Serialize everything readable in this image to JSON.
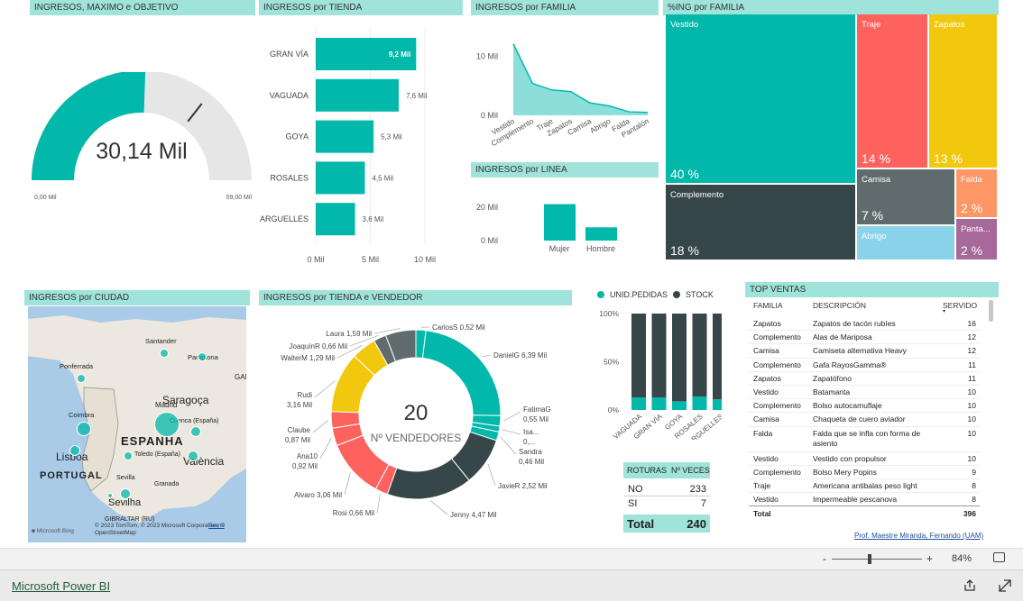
{
  "colors": {
    "teal": "#01b8aa",
    "dark": "#374649",
    "red": "#fd625e",
    "yellow": "#f2c80f",
    "gray": "#5f6b6d",
    "lightblue": "#8ad4eb",
    "orange": "#fe9666",
    "purple": "#a66999",
    "header": "#9fe3da"
  },
  "titles": {
    "gauge": "INGRESOS, MAXIMO e OBJETIVO",
    "tienda": "INGRESOS por TIENDA",
    "familia": "INGRESOS por FAMILIA",
    "treemap": "%ING por FAMILIA",
    "linea": "INGRESOS por LINEA",
    "ciudad": "INGRESOS por CIUDAD",
    "donut": "INGRESOS por TIENDA e VENDEDOR",
    "top": "TOP VENTAS"
  },
  "chart_data": [
    {
      "type": "gauge",
      "value": 30.14,
      "value_label": "30,14 Mil",
      "min_label": "0,00 Mil",
      "max_label": "59,00 Mil",
      "min": 0,
      "max": 59,
      "target": 42
    },
    {
      "type": "bar",
      "orientation": "horizontal",
      "categories": [
        "GRAN VÍA",
        "VAGUADA",
        "GOYA",
        "ROSALES",
        "ARGUELLES"
      ],
      "values": [
        9.2,
        7.6,
        5.3,
        4.5,
        3.6
      ],
      "data_labels": [
        "9,2 Mil",
        "7,6 Mil",
        "5,3 Mil",
        "4,5 Mil",
        "3,6 Mil"
      ],
      "xticks": [
        "0 Mil",
        "5 Mil",
        "10 Mil"
      ],
      "xlim": [
        0,
        10
      ]
    },
    {
      "type": "area",
      "categories": [
        "Vestido",
        "Complemento",
        "Traje",
        "Zapatos",
        "Camisa",
        "Abrigo",
        "Falda",
        "Pantalón"
      ],
      "values": [
        12.1,
        5.4,
        4.3,
        4.0,
        2.1,
        1.6,
        0.6,
        0.5
      ],
      "yticks": [
        "0 Mil",
        "10 Mil"
      ],
      "ylim": [
        0,
        12.5
      ]
    },
    {
      "type": "treemap",
      "items": [
        {
          "label": "Vestido",
          "pct": "40 %",
          "color": "#01b8aa"
        },
        {
          "label": "Complemento",
          "pct": "18 %",
          "color": "#374649"
        },
        {
          "label": "Traje",
          "pct": "14 %",
          "color": "#fd625e"
        },
        {
          "label": "Zapatos",
          "pct": "13 %",
          "color": "#f2c80f"
        },
        {
          "label": "Camisa",
          "pct": "7 %",
          "color": "#5f6b6d"
        },
        {
          "label": "Abrigo",
          "pct": "",
          "color": "#8ad4eb"
        },
        {
          "label": "Falda",
          "pct": "2 %",
          "color": "#fe9666"
        },
        {
          "label": "Panta...",
          "pct": "2 %",
          "color": "#a66999"
        }
      ]
    },
    {
      "type": "bar",
      "categories": [
        "Mujer",
        "Hombre"
      ],
      "values": [
        22,
        8
      ],
      "yticks": [
        "0 Mil",
        "20 Mil"
      ],
      "ylim": [
        0,
        25
      ]
    },
    {
      "type": "donut",
      "center_value": "20",
      "center_label": "Nº VENDEDORES",
      "slices": [
        {
          "label": "CarlosS 0,52 Mil",
          "value": 0.52,
          "color": "#01b8aa"
        },
        {
          "label": "DanielG 6,39 Mil",
          "value": 6.39,
          "color": "#01b8aa"
        },
        {
          "label": "FatimaG 0,55 Mil",
          "value": 0.55,
          "color": "#01b8aa"
        },
        {
          "label": "Isa... 0,...",
          "value": 0.3,
          "color": "#01b8aa"
        },
        {
          "label": "Sandra 0,46 Mil",
          "value": 0.46,
          "color": "#01b8aa"
        },
        {
          "label": "JavieR 2,52 Mil",
          "value": 2.52,
          "color": "#374649"
        },
        {
          "label": "Jenny 4,47 Mil",
          "value": 4.47,
          "color": "#374649"
        },
        {
          "label": "Rosi 0,66 Mil",
          "value": 0.66,
          "color": "#fd625e"
        },
        {
          "label": "Alvaro 3,06 Mil",
          "value": 3.06,
          "color": "#fd625e"
        },
        {
          "label": "Ana10 0,92 Mil",
          "value": 0.92,
          "color": "#fd625e"
        },
        {
          "label": "Claube 0,87 Mil",
          "value": 0.87,
          "color": "#fd625e"
        },
        {
          "label": "Rudi 3,16 Mil",
          "value": 3.16,
          "color": "#f2c80f"
        },
        {
          "label": "WalterM 1,29 Mil",
          "value": 1.29,
          "color": "#f2c80f"
        },
        {
          "label": "JoaquínR 0,66 Mil",
          "value": 0.66,
          "color": "#5f6b6d"
        },
        {
          "label": "Laura 1,59 Mil",
          "value": 1.59,
          "color": "#5f6b6d"
        }
      ]
    },
    {
      "type": "bar",
      "stacked": true,
      "legend": [
        "UNID.PEDIDAS",
        "STOCK"
      ],
      "categories": [
        "VAGUADA",
        "GRAN VÍA",
        "GOYA",
        "ROSALES",
        "ARGUELLES"
      ],
      "series": [
        {
          "name": "UNID.PEDIDAS",
          "values": [
            13,
            13,
            9,
            14,
            11
          ]
        },
        {
          "name": "STOCK",
          "values": [
            87,
            87,
            91,
            86,
            89
          ]
        }
      ],
      "yticks": [
        "0%",
        "50%",
        "100%"
      ],
      "ylim": [
        0,
        100
      ]
    }
  ],
  "map": {
    "cities": [
      "Santander",
      "Pamplona",
      "Ponferrada",
      "Saragoça",
      "Madrid",
      "Cuenca (España)",
      "Coimbra",
      "Lisboa",
      "ESPANHA",
      "Toledo (España)",
      "València",
      "PORTUGAL",
      "Sevilla",
      "Granada",
      "Sevilha",
      "GIBRALTAR (RU)",
      "GAMMA"
    ],
    "attribution": "© 2023 TomTom, © 2023 Microsoft Corporation, © OpenStreetMap",
    "terms": "Terms",
    "brand": "Microsoft Bing"
  },
  "roturas": {
    "headers": [
      "ROTURAS",
      "Nº VECES"
    ],
    "rows": [
      [
        "NO",
        "233"
      ],
      [
        "SI",
        "7"
      ]
    ],
    "total": [
      "Total",
      "240"
    ]
  },
  "top_ventas": {
    "headers": [
      "FAMILIA",
      "DESCRIPCIÓN",
      "SERVIDO"
    ],
    "rows": [
      [
        "Zapatos",
        "Zapatos de tacón rubíes",
        "16"
      ],
      [
        "Complemento",
        "Alas de Mariposa",
        "12"
      ],
      [
        "Camisa",
        "Camiseta alternativa Heavy",
        "12"
      ],
      [
        "Complemento",
        "Gafa RayosGamma®",
        "11"
      ],
      [
        "Zapatos",
        "Zapatófono",
        "11"
      ],
      [
        "Vestido",
        "Batamanta",
        "10"
      ],
      [
        "Complemento",
        "Bolso autocamuflaje",
        "10"
      ],
      [
        "Camisa",
        "Chaqueta de cuero aviador",
        "10"
      ],
      [
        "Falda",
        "Falda que se infla con forma de asiento",
        "10"
      ],
      [
        "Vestido",
        "Vestido con propulsor",
        "10"
      ],
      [
        "Complemento",
        "Bolso Mery Popins",
        "9"
      ],
      [
        "Traje",
        "Americana antibalas peso light",
        "8"
      ],
      [
        "Vestido",
        "Impermeable pescanova",
        "8"
      ]
    ],
    "total": [
      "Total",
      "",
      "396"
    ]
  },
  "credit": "Prof. Maestre Miranda, Fernando (UAM)",
  "footer": {
    "zoom": "84%",
    "minus": "-",
    "plus": "+",
    "brand": "Microsoft Power BI"
  }
}
